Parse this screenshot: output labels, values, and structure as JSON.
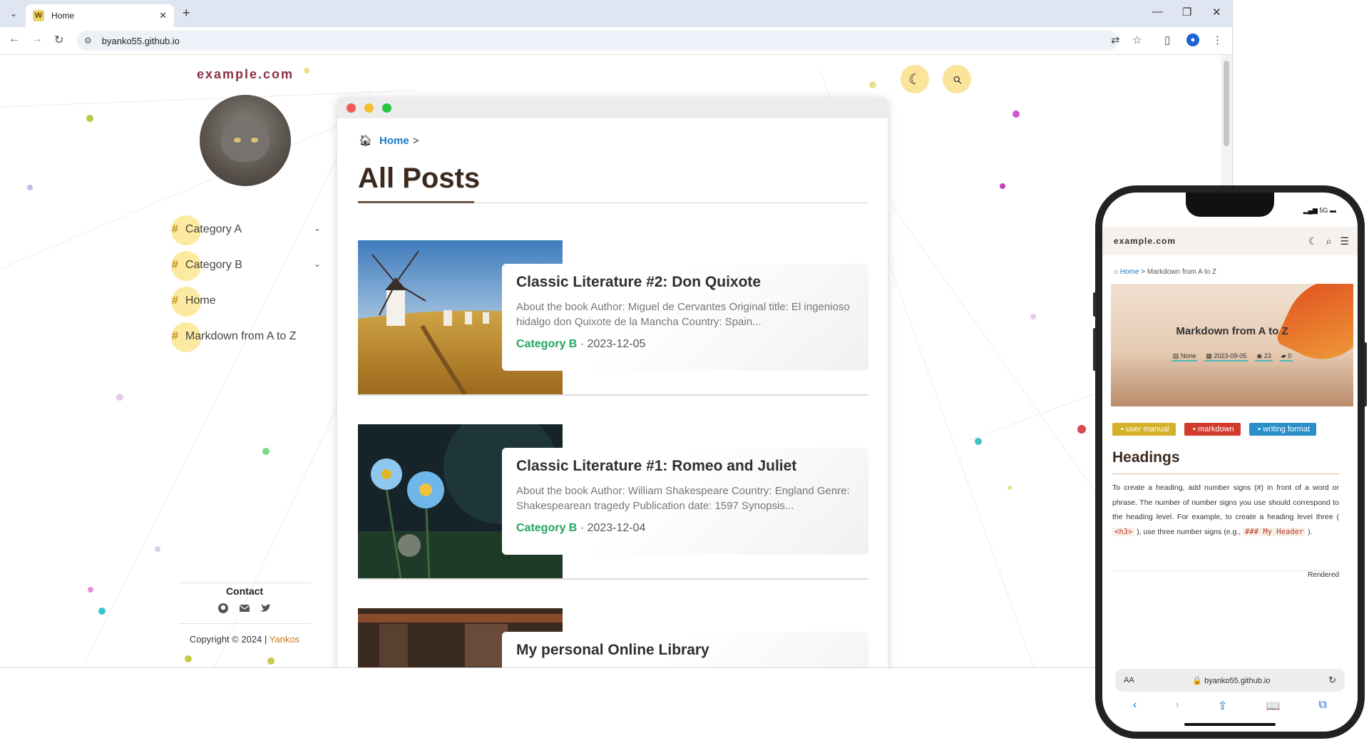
{
  "browser": {
    "tab_title": "Home",
    "favicon_letter": "W",
    "new_tab": "+",
    "close_tab": "✕",
    "url": "byanko55.github.io",
    "controls": {
      "minimize": "—",
      "maximize": "❐",
      "close": "✕"
    },
    "nav": {
      "back": "←",
      "forward": "→",
      "reload": "↻"
    },
    "tool_icons": {
      "translate": "⇄",
      "bookmark": "☆",
      "sidepanel": "▯",
      "menu": "⋮"
    }
  },
  "site": {
    "title": "example.com",
    "nav": [
      {
        "hash": "#",
        "label": "Category A",
        "chevron": "⌄"
      },
      {
        "hash": "#",
        "label": "Category B",
        "chevron": "⌄"
      },
      {
        "hash": "#",
        "label": "Home"
      },
      {
        "hash": "#",
        "label": "Markdown from A to Z"
      }
    ],
    "contact_title": "Contact",
    "contact_icons": [
      "github-icon",
      "mail-icon",
      "twitter-icon"
    ],
    "copyright_text": "Copyright © 2024 | ",
    "copyright_author": "Yankos",
    "dark_mode_icon": "☾",
    "search_icon": "⌕"
  },
  "main": {
    "breadcrumb_home": "Home",
    "breadcrumb_sep": ">",
    "page_title": "All Posts",
    "posts": [
      {
        "title": "Classic Literature #2: Don Quixote",
        "excerpt": "About the book Author: Miguel de Cervantes Original title: El ingenioso hidalgo don Quixote de la Mancha Country: Spain...",
        "category": "Category B",
        "date": "· 2023-12-05"
      },
      {
        "title": "Classic Literature #1: Romeo and Juliet",
        "excerpt": "About the book Author: William Shakespeare Country: England Genre: Shakespearean tragedy Publication date: 1597 Synopsis...",
        "category": "Category B",
        "date": "· 2023-12-04"
      },
      {
        "title": "My personal Online Library",
        "excerpt": "",
        "category": "",
        "date": ""
      }
    ]
  },
  "phone": {
    "status": "5G",
    "site_title": "example.com",
    "breadcrumb_home": "Home",
    "breadcrumb_rest": " > Markdown from A to Z",
    "hero_title": "Markdown from A to Z",
    "hero_meta": [
      "None",
      "2023-09-05",
      "23",
      "0"
    ],
    "tags": [
      {
        "label": "user manual",
        "color": "#d4b12a"
      },
      {
        "label": "markdown",
        "color": "#d33a2e"
      },
      {
        "label": "writing format",
        "color": "#2b8fc9"
      }
    ],
    "heading": "Headings",
    "body_1": "To create a heading, add number signs (#) in front of a word or phrase. The number of number signs you use should correspond to the heading level. For example, to create a heading level three (",
    "code_1": "<h3>",
    "body_2": "), use three number signs (e.g.,",
    "code_2": "### My Header",
    "body_3": ").",
    "rendered_label": "Rendered",
    "addr_aa": "AA",
    "addr_url": "🔒 byanko55.github.io",
    "addr_reload": "↻",
    "bottom_bar": [
      "‹",
      "›",
      "⇪",
      "📖",
      "⧉"
    ]
  }
}
